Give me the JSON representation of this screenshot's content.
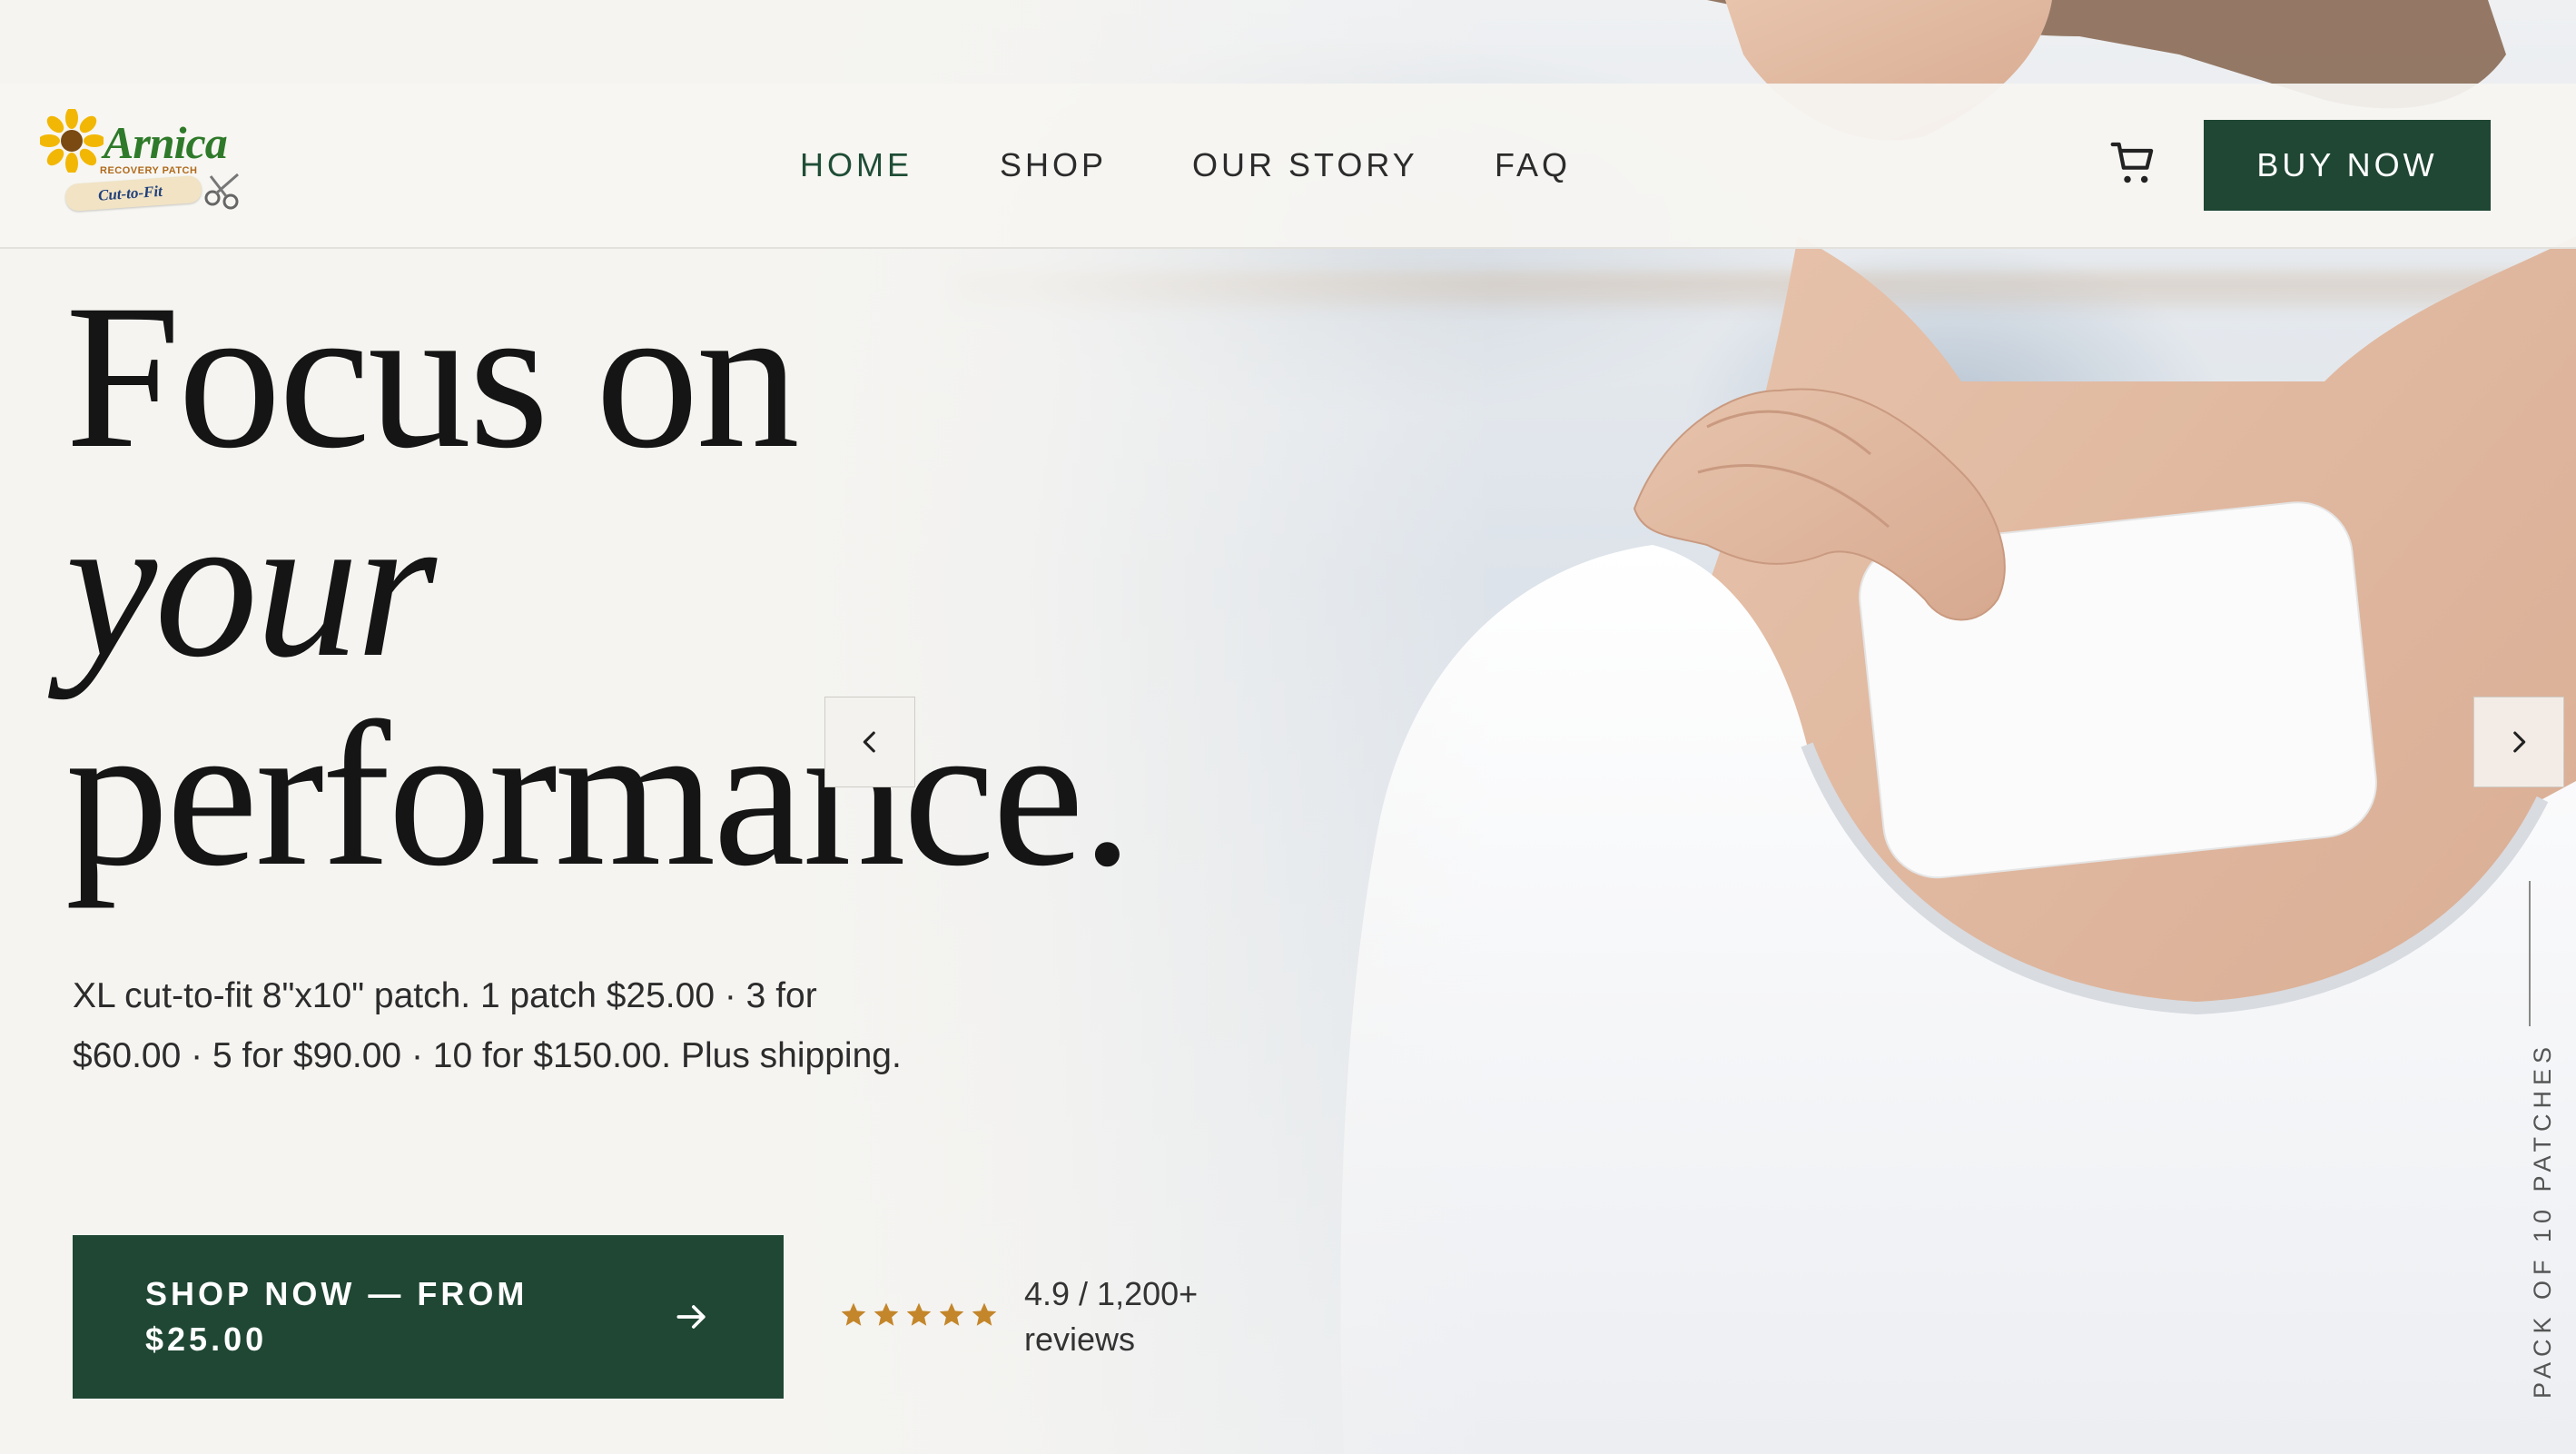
{
  "brand": {
    "logo_word": "Arnica",
    "logo_subtitle": "RECOVERY PATCH",
    "logo_tag": "Cut-to-Fit",
    "logo_icons": [
      "sunflower-icon",
      "scissors-icon"
    ]
  },
  "nav": {
    "items": [
      {
        "label": "HOME",
        "active": true
      },
      {
        "label": "SHOP",
        "active": false
      },
      {
        "label": "OUR STORY",
        "active": false
      },
      {
        "label": "FAQ",
        "active": false
      }
    ],
    "cart_icon": "cart-icon",
    "buy_now_label": "BUY NOW"
  },
  "hero": {
    "headline_line1": "Focus on",
    "headline_line2": "your",
    "headline_line3": "performance.",
    "description": "XL cut-to-fit 8\"x10\" patch. 1 patch $25.00 · 3 for $60.00 · 5 for $90.00 · 10 for $150.00. Plus shipping.",
    "cta_label": "SHOP NOW — FROM $25.00",
    "cta_icon": "arrow-right-icon",
    "rating_stars": 5,
    "rating_text": "4.9 / 1,200+ reviews",
    "side_label": "PACK OF 10 PATCHES"
  },
  "carousel": {
    "prev_icon": "chevron-left-icon",
    "next_icon": "chevron-right-icon"
  },
  "colors": {
    "accent_green": "#1f4734",
    "background": "#f5f4f1",
    "star_gold": "#c4862a",
    "text": "#151515"
  }
}
